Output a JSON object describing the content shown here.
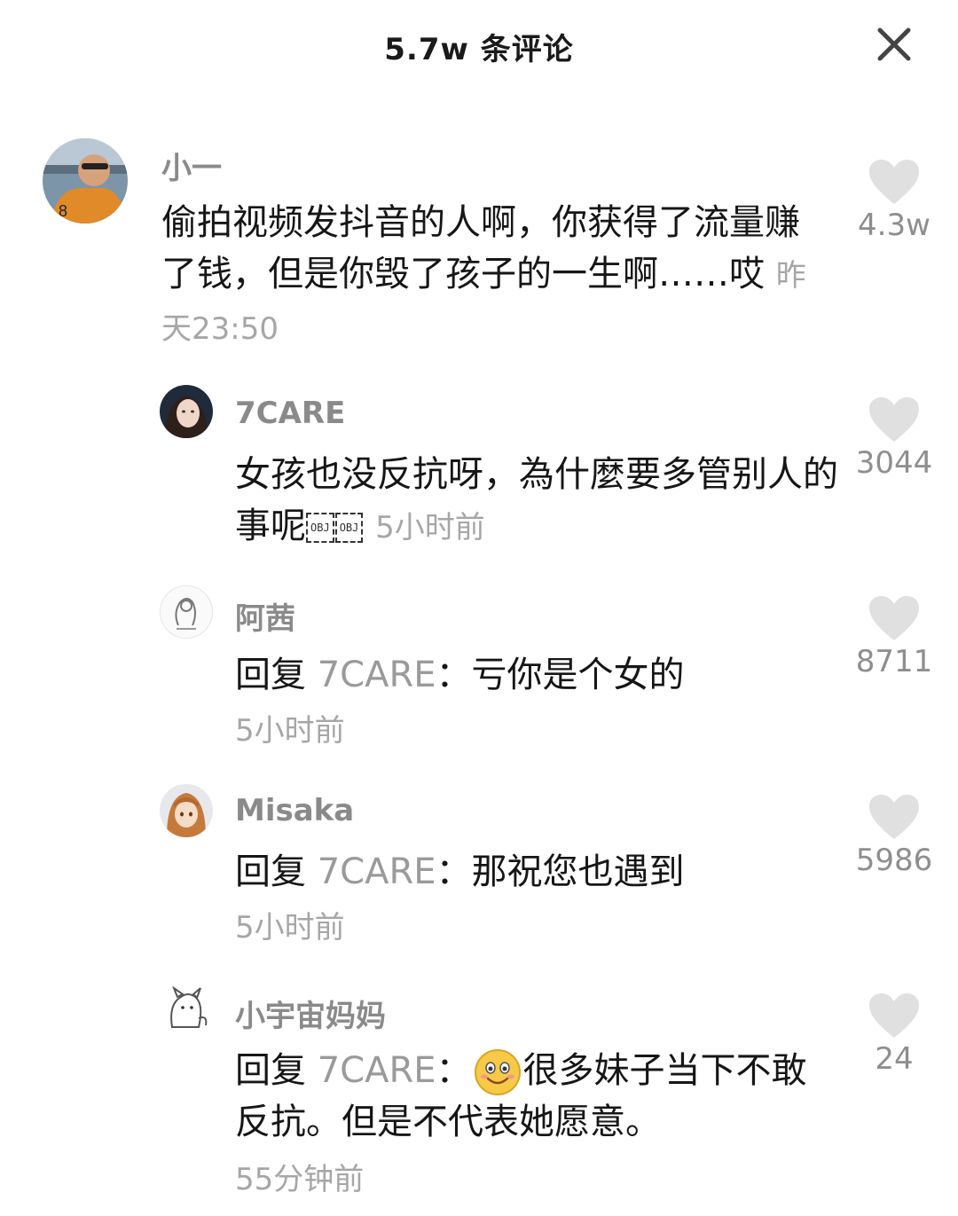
{
  "header": {
    "title": "5.7w 条评论"
  },
  "comments": [
    {
      "username": "小一",
      "text": "偷拍视频发抖音的人啊，你获得了流量赚了钱，但是你毁了孩子的一生啊……哎",
      "time": "昨天23:50",
      "likes": "4.3w"
    },
    {
      "username": "7CARE",
      "text": "女孩也没反抗呀，為什麼要多管别人的事呢",
      "obj1": "OBJ",
      "obj2": "OBJ",
      "time": "5小时前",
      "likes": "3044"
    },
    {
      "username": "阿茜",
      "reply_prefix": "回复",
      "reply_target": "7CARE",
      "text": "：亏你是个女的",
      "time": "5小时前",
      "likes": "8711"
    },
    {
      "username": "Misaka",
      "reply_prefix": "回复",
      "reply_target": "7CARE",
      "text": "：那祝您也遇到",
      "time": "5小时前",
      "likes": "5986"
    },
    {
      "username": "小宇宙妈妈",
      "reply_prefix": "回复",
      "reply_target": "7CARE",
      "text_before_emoji": "：",
      "emoji": "smile-emoji",
      "text": "很多妹子当下不敢反抗。但是不代表她愿意。",
      "time": "55分钟前",
      "likes": "24"
    }
  ],
  "icons": {
    "close": "close-icon",
    "like": "heart-icon"
  },
  "colors": {
    "username": "#8a8a8a",
    "time": "#a6a6a6",
    "heart": "#e0e0e0"
  }
}
